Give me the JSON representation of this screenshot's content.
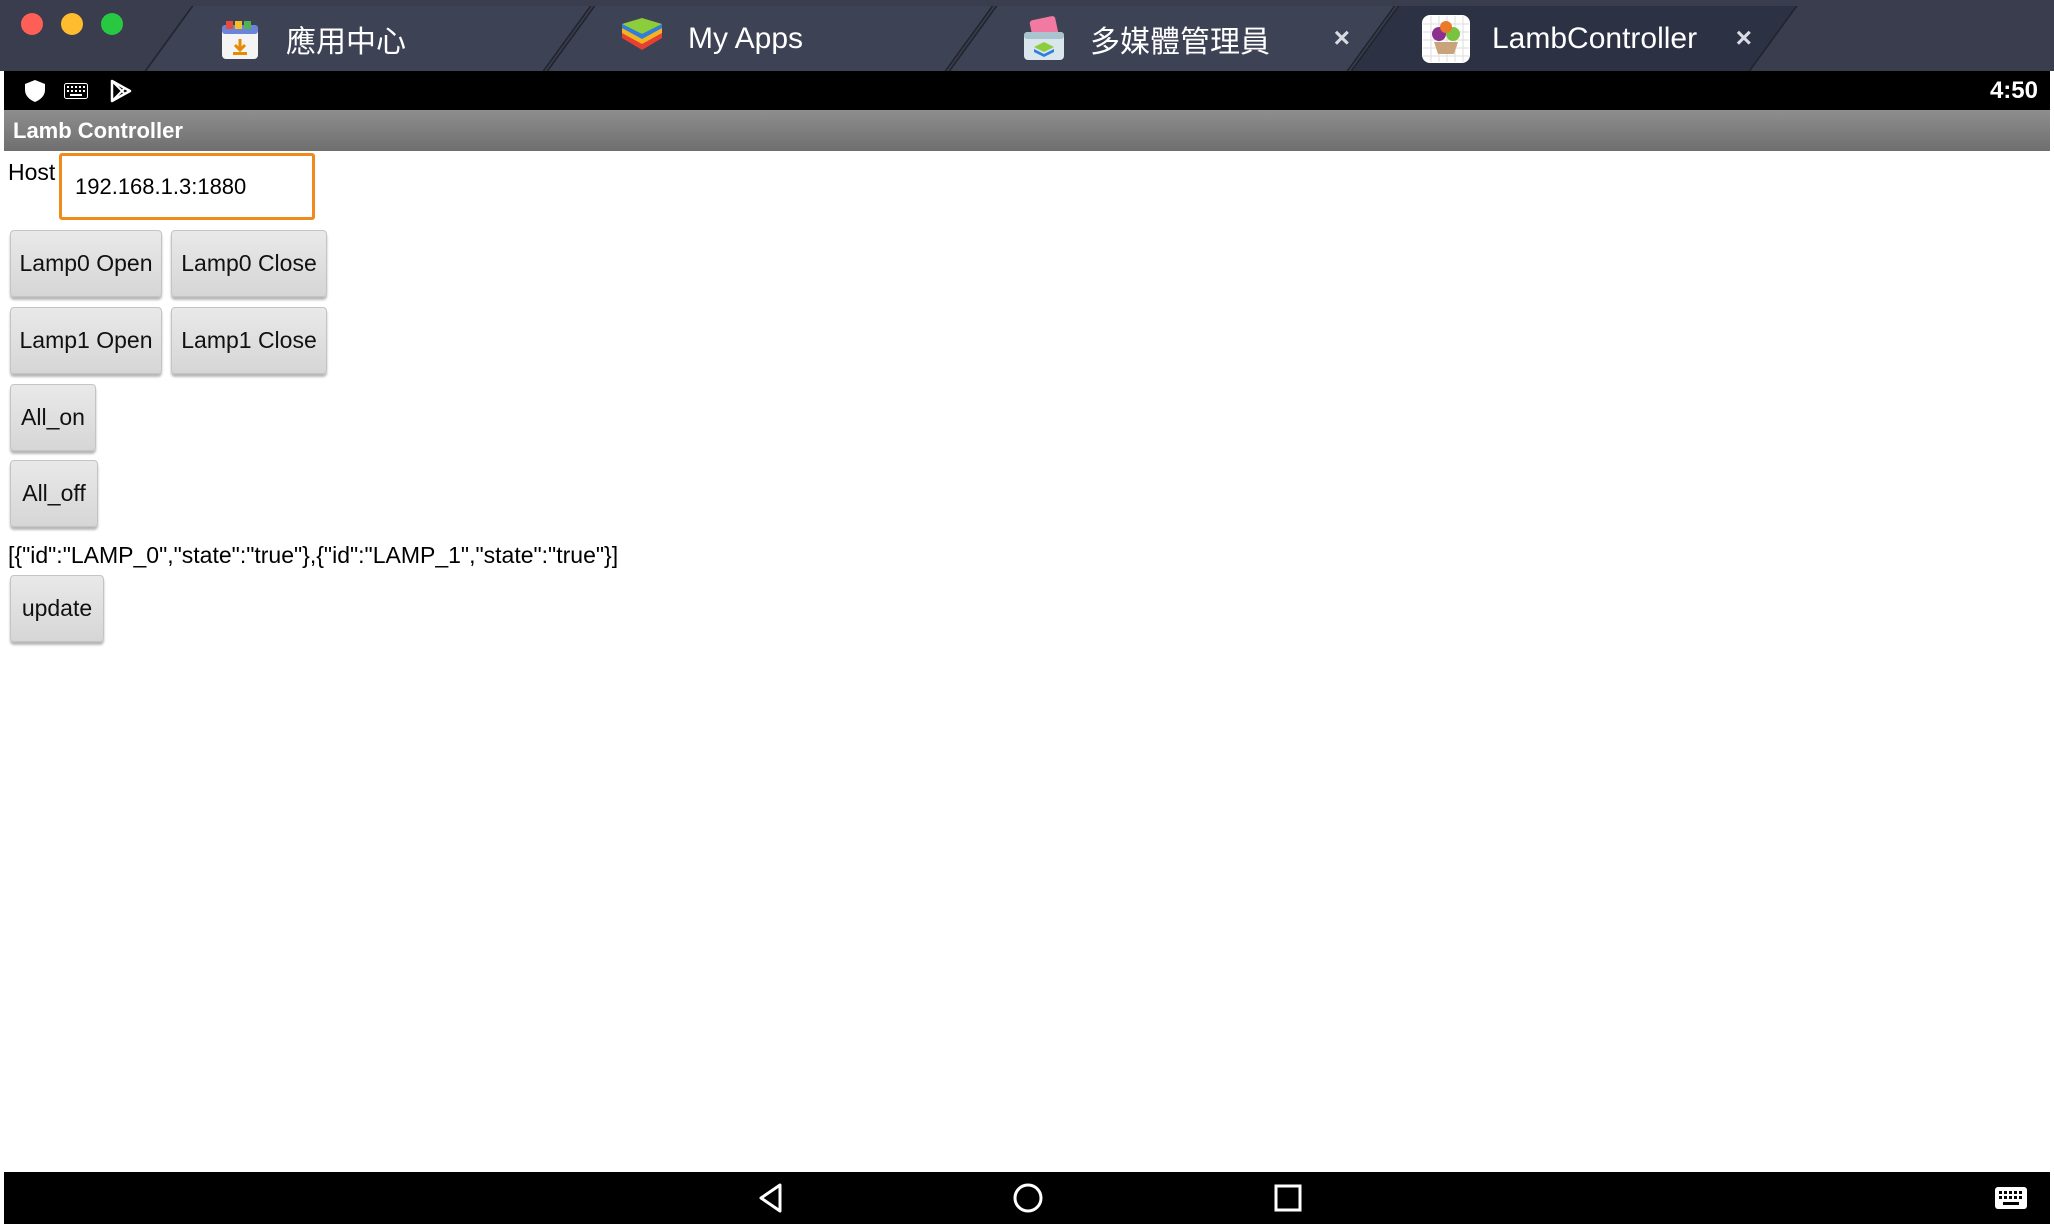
{
  "window": {
    "tabs": [
      {
        "label": "應用中心",
        "icon": "app-center-icon",
        "closable": false
      },
      {
        "label": "My Apps",
        "icon": "bluestacks-icon",
        "closable": false
      },
      {
        "label": "多媒體管理員",
        "icon": "media-manager-icon",
        "closable": true
      },
      {
        "label": "LambController",
        "icon": "lamb-controller-icon",
        "closable": true,
        "active": true
      }
    ],
    "close_glyph": "×"
  },
  "status_bar": {
    "time": "4:50",
    "icons": [
      "shield-icon",
      "keyboard-icon",
      "play-store-icon"
    ]
  },
  "action_bar": {
    "title": "Lamb Controller"
  },
  "host": {
    "label": "Host",
    "value": "192.168.1.3:1880"
  },
  "buttons": {
    "lamp0_open": "Lamp0 Open",
    "lamp0_close": "Lamp0 Close",
    "lamp1_open": "Lamp1 Open",
    "lamp1_close": "Lamp1 Close",
    "all_on": "All_on",
    "all_off": "All_off",
    "update": "update"
  },
  "state_text": "[{\"id\":\"LAMP_0\",\"state\":\"true\"},{\"id\":\"LAMP_1\",\"state\":\"true\"}]",
  "nav_bar": {
    "icons": [
      "back-icon",
      "home-icon",
      "recents-icon",
      "keyboard-icon"
    ]
  },
  "colors": {
    "tab_bar": "#3a3d4d",
    "input_focus": "#f08a1c",
    "status_bar": "#000000"
  }
}
